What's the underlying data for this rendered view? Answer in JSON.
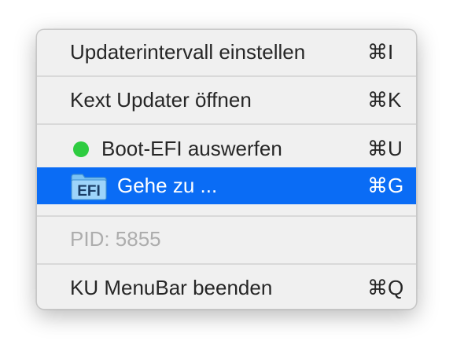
{
  "menu": {
    "items": [
      {
        "label": "Updaterintervall einstellen",
        "shortcut": "⌘I"
      },
      {
        "label": "Kext Updater öffnen",
        "shortcut": "⌘K"
      },
      {
        "label": "Boot-EFI auswerfen",
        "shortcut": "⌘U",
        "icon": "green-dot-icon"
      },
      {
        "label": "Gehe zu ...",
        "shortcut": "⌘G",
        "icon": "efi-folder-icon",
        "selected": true
      },
      {
        "label": "PID: 5855",
        "disabled": true
      },
      {
        "label": "KU MenuBar beenden",
        "shortcut": "⌘Q"
      }
    ],
    "efi_icon_text": "EFI",
    "colors": {
      "selection": "#0a6cf5",
      "status_dot": "#2ecc40",
      "disabled_text": "#adadad"
    }
  }
}
